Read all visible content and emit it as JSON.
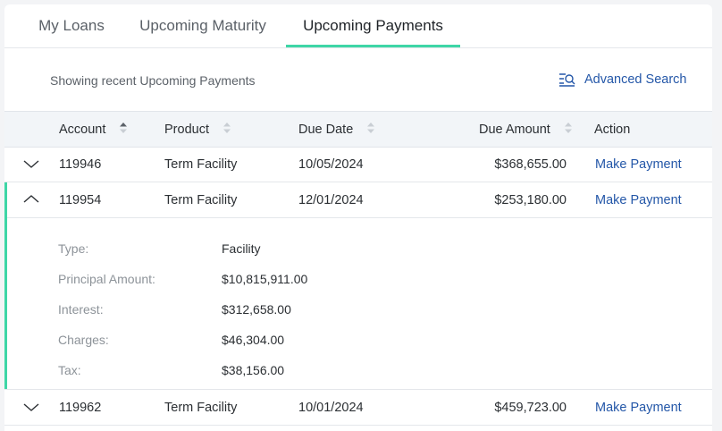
{
  "tabs": [
    {
      "label": "My Loans",
      "active": false
    },
    {
      "label": "Upcoming Maturity",
      "active": false
    },
    {
      "label": "Upcoming Payments",
      "active": true
    }
  ],
  "subheader": {
    "showing_text": "Showing recent Upcoming Payments",
    "advanced_search_label": "Advanced Search"
  },
  "table": {
    "columns": [
      "Account",
      "Product",
      "Due Date",
      "Due Amount",
      "Action"
    ],
    "rows": [
      {
        "account": "119946",
        "product": "Term Facility",
        "due_date": "10/05/2024",
        "due_amount": "$368,655.00",
        "action": "Make Payment",
        "expanded": false
      },
      {
        "account": "119954",
        "product": "Term Facility",
        "due_date": "12/01/2024",
        "due_amount": "$253,180.00",
        "action": "Make Payment",
        "expanded": true
      },
      {
        "account": "119962",
        "product": "Term Facility",
        "due_date": "10/01/2024",
        "due_amount": "$459,723.00",
        "action": "Make Payment",
        "expanded": false
      }
    ]
  },
  "details": [
    {
      "label": "Type:",
      "value": "Facility"
    },
    {
      "label": "Principal Amount:",
      "value": "$10,815,911.00"
    },
    {
      "label": "Interest:",
      "value": "$312,658.00"
    },
    {
      "label": "Charges:",
      "value": "$46,304.00"
    },
    {
      "label": "Tax:",
      "value": "$38,156.00"
    }
  ],
  "colors": {
    "accent": "#3ed6a6",
    "link": "#2457a8",
    "header_bg": "#f2f5f8"
  }
}
